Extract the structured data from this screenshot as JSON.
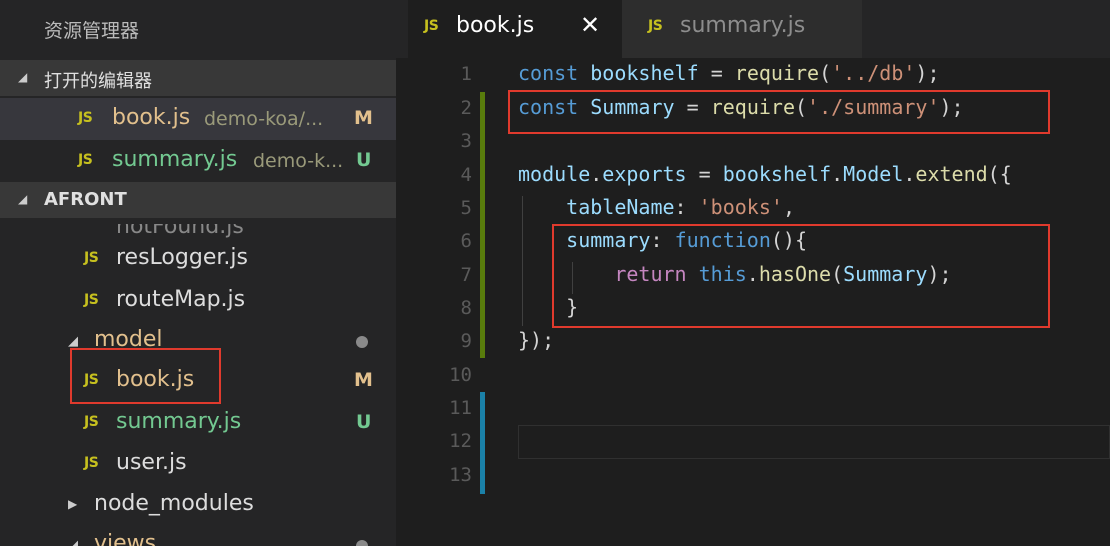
{
  "explorer": {
    "title": "资源管理器",
    "open_editors_label": "打开的编辑器",
    "open_editors": [
      {
        "icon": "JS",
        "name": "book.js",
        "path": "demo-koa/...",
        "badge": "M"
      },
      {
        "icon": "JS",
        "name": "summary.js",
        "path": "demo-k...",
        "badge": "U"
      }
    ],
    "project_label": "AFRONT",
    "partial_item": "notFound.js",
    "tree": [
      {
        "icon": "JS",
        "name": "resLogger.js"
      },
      {
        "icon": "JS",
        "name": "routeMap.js"
      },
      {
        "folder": "model"
      },
      {
        "icon": "JS",
        "name": "book.js",
        "badge": "M"
      },
      {
        "icon": "JS",
        "name": "summary.js",
        "badge": "U"
      },
      {
        "icon": "JS",
        "name": "user.js"
      },
      {
        "folder": "node_modules"
      },
      {
        "folder": "views"
      }
    ]
  },
  "tabs": [
    {
      "icon": "JS",
      "name": "book.js",
      "close": "✕"
    },
    {
      "icon": "JS",
      "name": "summary.js"
    }
  ],
  "line_numbers": [
    "1",
    "2",
    "3",
    "4",
    "5",
    "6",
    "7",
    "8",
    "9",
    "10",
    "11",
    "12",
    "13"
  ],
  "colors": {
    "modified": "#e2c08d",
    "untracked": "#73c991",
    "highlight_box": "#e03a2d",
    "gutter_added": "#587c0c",
    "gutter_blue": "#1b81a8"
  }
}
